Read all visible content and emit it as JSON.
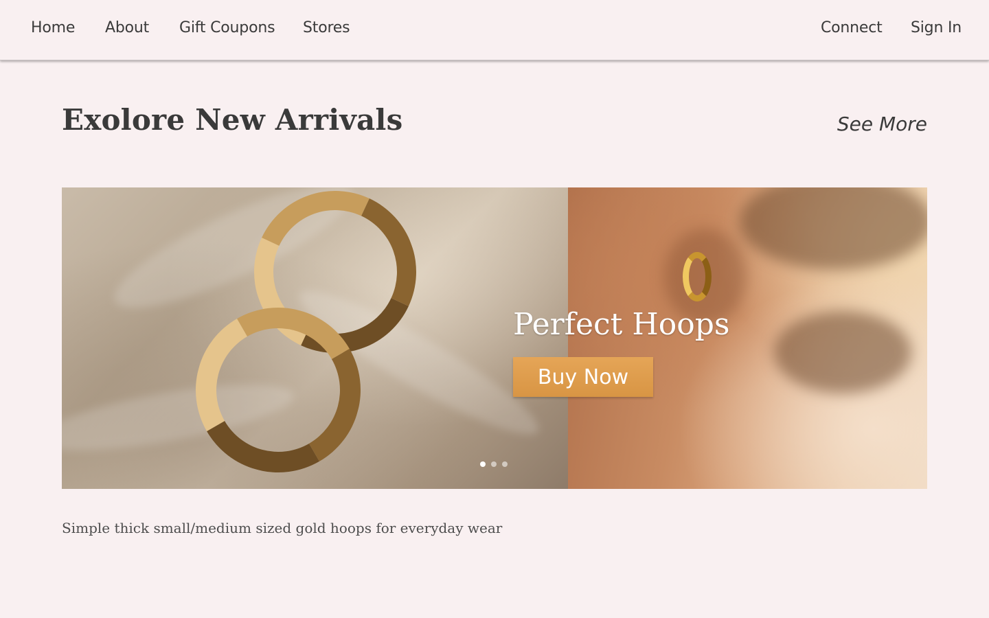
{
  "nav": {
    "left": [
      "Home",
      "About",
      "Gift Coupons",
      "Stores"
    ],
    "right": [
      "Connect",
      "Sign In"
    ]
  },
  "section": {
    "heading": "Exolore New Arrivals",
    "see_more": "See More"
  },
  "carousel": {
    "slide_title": "Perfect Hoops",
    "button_label": "Buy Now",
    "dots_total": 3,
    "active_dot": 1
  },
  "caption": "Simple thick small/medium sized gold hoops for everyday wear",
  "colors": {
    "background": "#f9f0f1",
    "button": "#dd9a4b",
    "text": "#3a3a3a"
  }
}
